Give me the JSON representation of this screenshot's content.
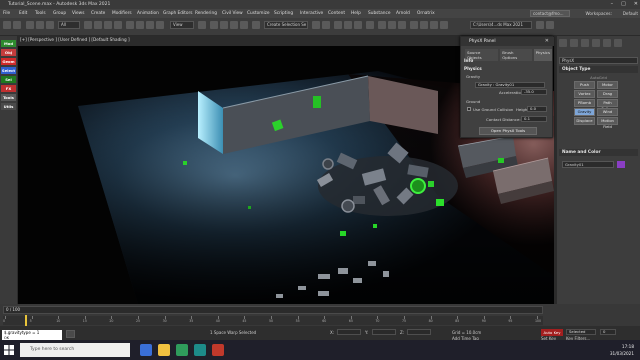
{
  "window": {
    "title": "Tutorial_Scene.max - Autodesk 3ds Max 2021"
  },
  "menu": {
    "items": [
      "File",
      "Edit",
      "Tools",
      "Group",
      "Views",
      "Create",
      "Modifiers",
      "Animation",
      "Graph Editors",
      "Rendering",
      "Civil View",
      "Customize",
      "Scripting",
      "Interactive",
      "Content",
      "Help",
      "Substance",
      "Arnold",
      "Ornatrix"
    ],
    "sign_in": "contact@fmo...",
    "workspaces_label": "Workspaces:",
    "workspace_value": "Default"
  },
  "toolbar": {
    "filter_select": "All",
    "view_select": "View",
    "selection_set": "Create Selection Se",
    "path": "C:\\Users\\4...ds Max 2021"
  },
  "ribbon_tabs": [
    {
      "label": "Mod",
      "color": "#2e8b2e"
    },
    {
      "label": "Obj",
      "color": "#c43c3c"
    },
    {
      "label": "Geom",
      "color": "#cf2a2a"
    },
    {
      "label": "Select",
      "color": "#3060d0"
    },
    {
      "label": "Sel",
      "color": "#1f7a1f"
    },
    {
      "label": "FX",
      "color": "#c03030"
    },
    {
      "label": "Tools",
      "color": "#5a5a5a"
    },
    {
      "label": "Utils",
      "color": "#4a4a4a"
    }
  ],
  "viewport": {
    "label": "[+] [Perspective ] [User Defined ] [Default Shading ]"
  },
  "physx": {
    "title": "PhysX Panel",
    "tabs": [
      "Source Objects",
      "Brush Options",
      "Physics"
    ],
    "sections": {
      "info": "Info",
      "physics": "Physics",
      "gravity": "Gravity",
      "ground": "Ground"
    },
    "gravity_field": "Gravity : Gravity01",
    "acceleration_label": "Acceleration:",
    "acceleration_value": "-35.0",
    "ground_collision_label": "Use Ground Collision",
    "height_label": "Height:",
    "height_value": "0.0",
    "contact_label": "Contact Distance:",
    "contact_value": "0.1",
    "open_tools_button": "Open PhysX Tools"
  },
  "command_panel": {
    "dropdown": "PhysX",
    "object_type_header": "Object Type",
    "autogrid_label": "AutoGrid",
    "buttons": [
      "Push",
      "Motor",
      "Vortex",
      "Drag",
      "PBomb",
      "Path Follow",
      "Gravity",
      "Wind",
      "Displace",
      "Motion Field"
    ],
    "name_color_header": "Name and Color",
    "object_name": "Gravity01",
    "object_color": "#8a3ec4"
  },
  "timeline": {
    "frame_display": "0 / 100",
    "ruler_labels": [
      "0",
      "5",
      "10",
      "15",
      "20",
      "25",
      "30",
      "35",
      "40",
      "45",
      "50",
      "55",
      "60",
      "65",
      "70",
      "75",
      "80",
      "85",
      "90",
      "95",
      "100"
    ]
  },
  "statusbar": {
    "maxscript_line1": "$.gravitytype = 1",
    "maxscript_line2": "OK",
    "selection_status": "1 Space Warp Selected",
    "x_label": "X:",
    "y_label": "Y:",
    "z_label": "Z:",
    "grid": "Grid = 10.0cm",
    "add_time_tag": "Add Time Tag",
    "auto_key": "Auto Key",
    "set_key": "Set Key",
    "key_filters": "Key Filters...",
    "selected_dd": "Selected",
    "frame_value": "0"
  },
  "taskbar": {
    "search_placeholder": "Type here to search",
    "time": "17:18",
    "date": "31/03/2021"
  }
}
